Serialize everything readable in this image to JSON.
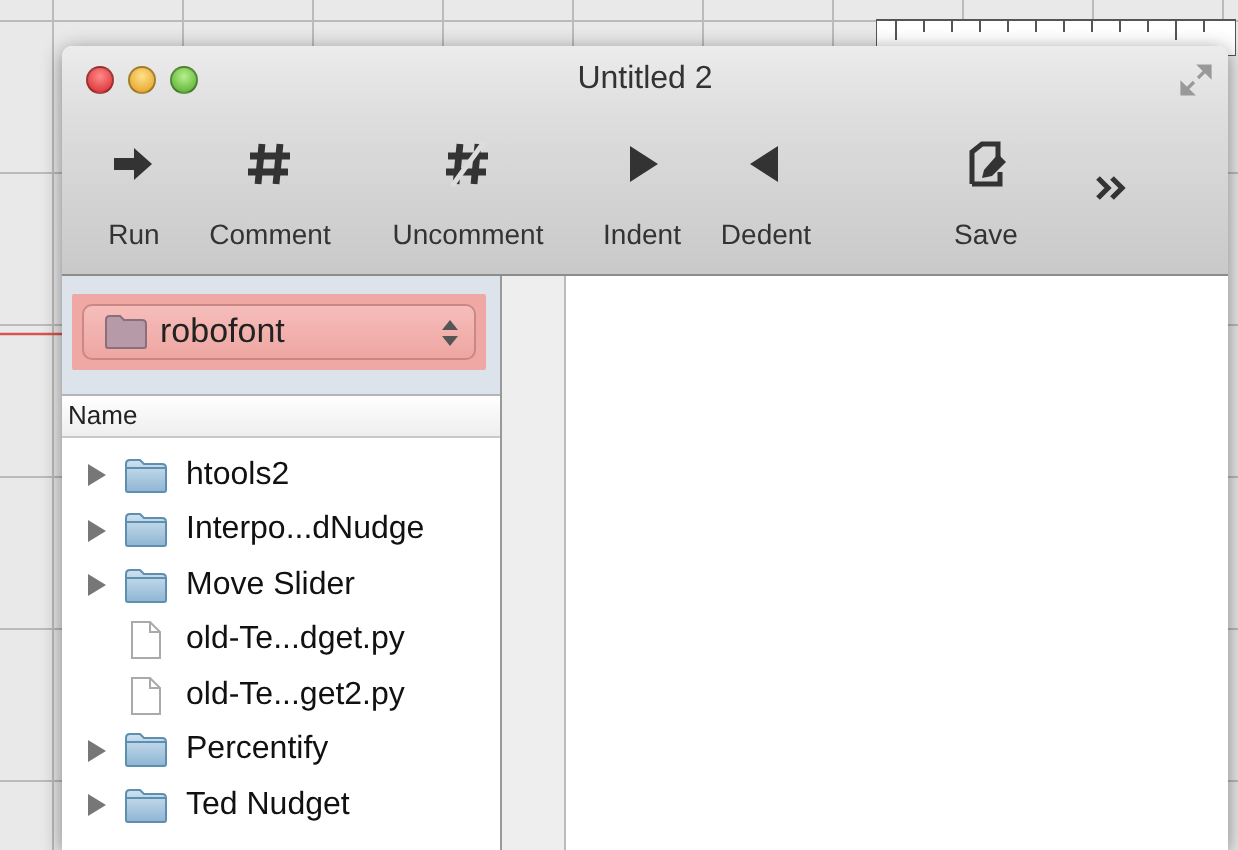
{
  "window": {
    "title": "Untitled 2"
  },
  "toolbar": [
    {
      "kind": "run",
      "label": "Run"
    },
    {
      "kind": "comment",
      "label": "Comment"
    },
    {
      "kind": "uncomment",
      "label": "Uncomment"
    },
    {
      "kind": "indent",
      "label": "Indent"
    },
    {
      "kind": "dedent",
      "label": "Dedent"
    },
    {
      "kind": "save",
      "label": "Save"
    }
  ],
  "sidebar": {
    "folder_popup": {
      "value": "robofont"
    },
    "column": "Name",
    "items": [
      {
        "kind": "folder",
        "name": "htools2",
        "expanded": false
      },
      {
        "kind": "folder",
        "name": "Interpo...dNudge",
        "expanded": false
      },
      {
        "kind": "folder",
        "name": "Move Slider",
        "expanded": false
      },
      {
        "kind": "file",
        "name": "old-Te...dget.py"
      },
      {
        "kind": "file",
        "name": "old-Te...get2.py"
      },
      {
        "kind": "folder",
        "name": "Percentify",
        "expanded": false
      },
      {
        "kind": "folder",
        "name": "Ted Nudget",
        "expanded": false
      }
    ]
  }
}
